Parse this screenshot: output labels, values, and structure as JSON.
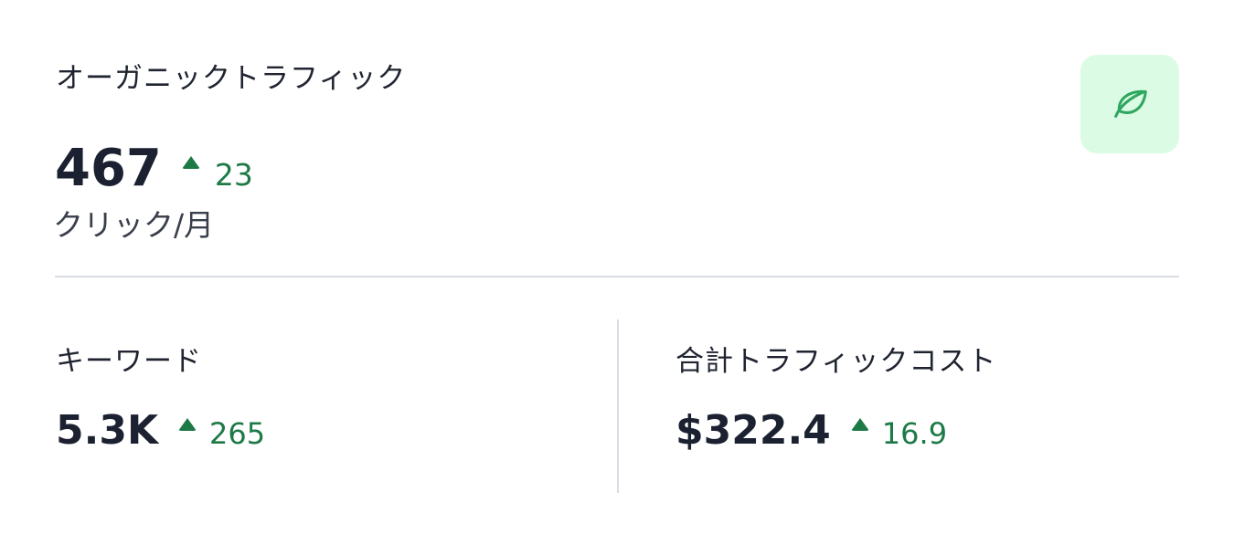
{
  "card": {
    "title": "オーガニックトラフィック",
    "icon": "leaf-icon",
    "accent_color": "#1d7a47",
    "badge_color": "#dcfbe4"
  },
  "main_metric": {
    "value": "467",
    "delta": "23",
    "unit": "クリック/月"
  },
  "keywords": {
    "label": "キーワード",
    "value": "5.3K",
    "delta": "265"
  },
  "traffic_cost": {
    "label": "合計トラフィックコスト",
    "value": "$322.4",
    "delta": "16.9"
  }
}
